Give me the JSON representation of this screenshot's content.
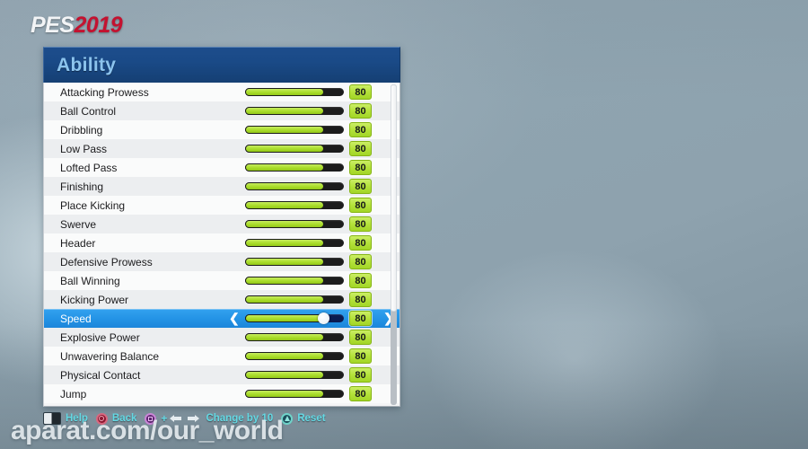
{
  "logo": {
    "brand": "PES",
    "year": "2019"
  },
  "panel": {
    "title": "Ability",
    "value_max": 99,
    "colors": {
      "header_blue": "#1a4a87",
      "title_text": "#8cc4ee",
      "selection_blue": "#2494e6",
      "bar_fill_green": "#a9dd2a",
      "bar_track_dark": "#1c1c1c",
      "badge_green": "#b4e23a",
      "accent_cyan": "#63d9e4",
      "logo_red": "#c41230"
    },
    "selected_index": 12,
    "scroll": {
      "thumb_fraction": 0.71,
      "position": "top"
    },
    "rows": [
      {
        "label": "Attacking Prowess",
        "value": "80",
        "fill_percent": 80,
        "selected": false
      },
      {
        "label": "Ball Control",
        "value": "80",
        "fill_percent": 80,
        "selected": false
      },
      {
        "label": "Dribbling",
        "value": "80",
        "fill_percent": 80,
        "selected": false
      },
      {
        "label": "Low Pass",
        "value": "80",
        "fill_percent": 80,
        "selected": false
      },
      {
        "label": "Lofted Pass",
        "value": "80",
        "fill_percent": 80,
        "selected": false
      },
      {
        "label": "Finishing",
        "value": "80",
        "fill_percent": 80,
        "selected": false
      },
      {
        "label": "Place Kicking",
        "value": "80",
        "fill_percent": 80,
        "selected": false
      },
      {
        "label": "Swerve",
        "value": "80",
        "fill_percent": 80,
        "selected": false
      },
      {
        "label": "Header",
        "value": "80",
        "fill_percent": 80,
        "selected": false
      },
      {
        "label": "Defensive Prowess",
        "value": "80",
        "fill_percent": 80,
        "selected": false
      },
      {
        "label": "Ball Winning",
        "value": "80",
        "fill_percent": 80,
        "selected": false
      },
      {
        "label": "Kicking Power",
        "value": "80",
        "fill_percent": 80,
        "selected": false
      },
      {
        "label": "Speed",
        "value": "80",
        "fill_percent": 80,
        "selected": true
      },
      {
        "label": "Explosive Power",
        "value": "80",
        "fill_percent": 80,
        "selected": false
      },
      {
        "label": "Unwavering Balance",
        "value": "80",
        "fill_percent": 80,
        "selected": false
      },
      {
        "label": "Physical Contact",
        "value": "80",
        "fill_percent": 80,
        "selected": false
      },
      {
        "label": "Jump",
        "value": "80",
        "fill_percent": 80,
        "selected": false
      }
    ],
    "selected_row_arrows": {
      "left": "❮",
      "right": "❯"
    }
  },
  "footer": {
    "hints": [
      {
        "icon": "touchpad-icon",
        "label": "Help"
      },
      {
        "icon": "ps-circle-icon",
        "label": "Back"
      },
      {
        "icon": "ps-square-icon",
        "plus": "+",
        "icon2": "dpad-left-icon",
        "icon3": "dpad-right-icon",
        "label": "Change by 10"
      },
      {
        "icon": "ps-triangle-icon",
        "label": "Reset"
      }
    ]
  },
  "watermark": {
    "text": "aparat.com/our_world"
  }
}
